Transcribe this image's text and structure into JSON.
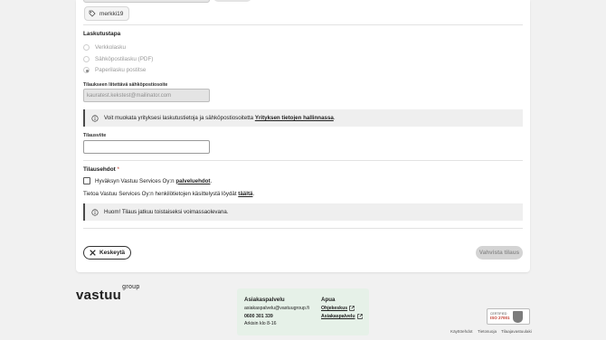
{
  "tag": {
    "label": "merkki19"
  },
  "billing": {
    "title": "Laskutustapa",
    "options": [
      {
        "label": "Verkkolasku",
        "checked": false
      },
      {
        "label": "Sähköpostilasku (PDF)",
        "checked": false
      },
      {
        "label": "Paperilasku postitse",
        "checked": true
      }
    ]
  },
  "email": {
    "label": "Tilaukseen liitettävä sähköpostiosoite",
    "value": "kauratest.kekstest@mailinator.com"
  },
  "info_notice": {
    "text": "Voit muokata yrityksesi laskutustietoja ja sähköpostiosoitetta",
    "link": "Yrityksen tietojen hallinnassa",
    "suffix": "."
  },
  "reference": {
    "label": "Tilausviite",
    "value": ""
  },
  "terms": {
    "title": "Tilausehdot",
    "required_mark": "*",
    "accept_text": "Hyväksyn Vastuu Services Oy:n",
    "accept_link": "palveluehdot",
    "accept_suffix": ".",
    "privacy_text": "Tietoa Vastuu Services Oy:n henkilötietojen käsittelystä löydät",
    "privacy_link": "täältä",
    "privacy_suffix": "."
  },
  "warning_notice": {
    "text": "Huom! Tilaus jatkuu toistaiseksi voimassaolevana."
  },
  "actions": {
    "cancel": "Keskeytä",
    "confirm": "Vahvista tilaus"
  },
  "footer": {
    "logo": "vastuu",
    "logo_sup": "group",
    "contact": {
      "title": "Asiakaspalvelu",
      "email": "asiakaspalvelu@vastuugroup.fi",
      "phone": "0600 301 339",
      "hours": "Arkisin klo 8-16"
    },
    "help": {
      "title": "Apua",
      "links": [
        "Ohjekeskus",
        "Asiakaspalvelu"
      ]
    },
    "iso": {
      "line1": "CERTIFIED",
      "line2": "ISO 27001"
    },
    "links": [
      "Käyttöehdot",
      "Tietosuoja",
      "Tilaajavastuulaki"
    ]
  }
}
